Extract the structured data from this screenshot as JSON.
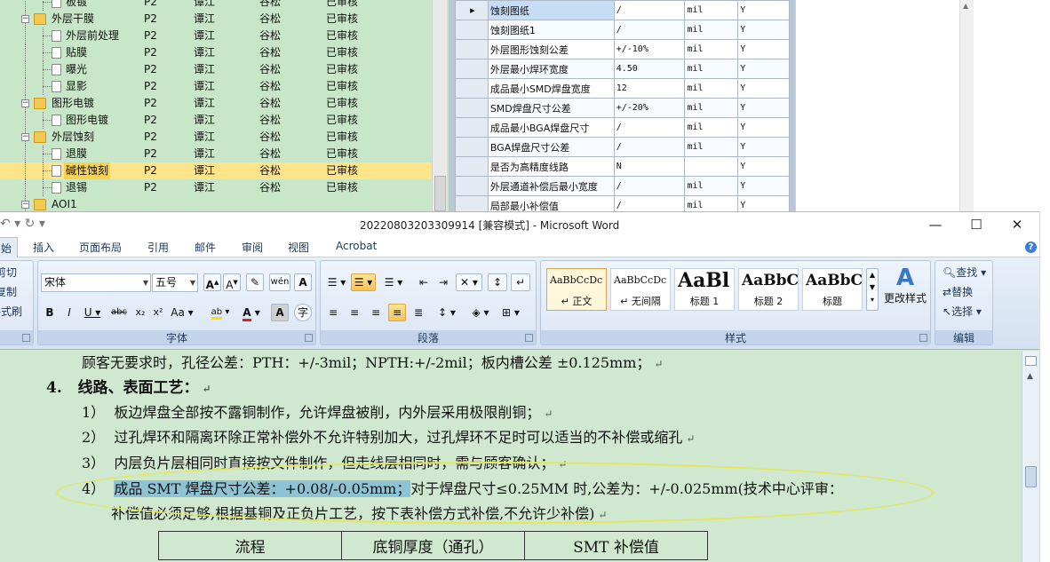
{
  "tree": {
    "rows": [
      {
        "name": "板镀",
        "code": "P2",
        "person": "谭江",
        "reviewer": "谷松",
        "status": "已审核",
        "icon": "file",
        "depth": 2
      },
      {
        "name": "外层干膜",
        "code": "P2",
        "person": "谭江",
        "reviewer": "谷松",
        "status": "已审核",
        "icon": "folder",
        "depth": 1
      },
      {
        "name": "外层前处理",
        "code": "P2",
        "person": "谭江",
        "reviewer": "谷松",
        "status": "已审核",
        "icon": "file",
        "depth": 2
      },
      {
        "name": "贴膜",
        "code": "P2",
        "person": "谭江",
        "reviewer": "谷松",
        "status": "已审核",
        "icon": "file",
        "depth": 2
      },
      {
        "name": "曝光",
        "code": "P2",
        "person": "谭江",
        "reviewer": "谷松",
        "status": "已审核",
        "icon": "file",
        "depth": 2
      },
      {
        "name": "显影",
        "code": "P2",
        "person": "谭江",
        "reviewer": "谷松",
        "status": "已审核",
        "icon": "file",
        "depth": 2
      },
      {
        "name": "图形电镀",
        "code": "P2",
        "person": "谭江",
        "reviewer": "谷松",
        "status": "已审核",
        "icon": "folder",
        "depth": 1
      },
      {
        "name": "图形电镀",
        "code": "P2",
        "person": "谭江",
        "reviewer": "谷松",
        "status": "已审核",
        "icon": "file",
        "depth": 2
      },
      {
        "name": "外层蚀刻",
        "code": "P2",
        "person": "谭江",
        "reviewer": "谷松",
        "status": "已审核",
        "icon": "folder",
        "depth": 1
      },
      {
        "name": "退膜",
        "code": "P2",
        "person": "谭江",
        "reviewer": "谷松",
        "status": "已审核",
        "icon": "file",
        "depth": 2
      },
      {
        "name": "碱性蚀刻",
        "code": "P2",
        "person": "谭江",
        "reviewer": "谷松",
        "status": "已审核",
        "icon": "file",
        "depth": 2,
        "selected": true
      },
      {
        "name": "退锡",
        "code": "P2",
        "person": "谭江",
        "reviewer": "谷松",
        "status": "已审核",
        "icon": "file",
        "depth": 2
      },
      {
        "name": "AOI1",
        "code": "",
        "person": "",
        "reviewer": "",
        "status": "",
        "icon": "folder",
        "depth": 1
      }
    ]
  },
  "grid": {
    "rows": [
      {
        "param": "蚀刻图纸",
        "value": "/",
        "unit": "mil",
        "flag": "Y",
        "current": true
      },
      {
        "param": "蚀刻图纸1",
        "value": "/",
        "unit": "mil",
        "flag": "Y"
      },
      {
        "param": "外层图形蚀刻公差",
        "value": "+/-10%",
        "unit": "mil",
        "flag": "Y"
      },
      {
        "param": "外层最小焊环宽度",
        "value": "4.50",
        "unit": "mil",
        "flag": "Y"
      },
      {
        "param": "成品最小SMD焊盘宽度",
        "value": "12",
        "unit": "mil",
        "flag": "Y"
      },
      {
        "param": "SMD焊盘尺寸公差",
        "value": "+/-20%",
        "unit": "mil",
        "flag": "Y"
      },
      {
        "param": "成品最小BGA焊盘尺寸",
        "value": "/",
        "unit": "mil",
        "flag": "Y"
      },
      {
        "param": "BGA焊盘尺寸公差",
        "value": "/",
        "unit": "mil",
        "flag": "Y"
      },
      {
        "param": "是否为高精度线路",
        "value": "N",
        "unit": "",
        "flag": "Y"
      },
      {
        "param": "外层通道补偿后最小宽度",
        "value": "/",
        "unit": "mil",
        "flag": "Y"
      },
      {
        "param": "局部最小补偿值",
        "value": "/",
        "unit": "mil",
        "flag": "Y"
      }
    ]
  },
  "word": {
    "title": "20220803203309914 [兼容模式] - Microsoft Word",
    "tabs": [
      "始",
      "插入",
      "页面布局",
      "引用",
      "邮件",
      "审阅",
      "视图",
      "Acrobat"
    ],
    "clipboard": {
      "cut": "剪切",
      "copy": "复制",
      "painter": "格式刷"
    },
    "font": {
      "name": "宋体",
      "size": "五号",
      "group_label": "字体"
    },
    "paragraph": {
      "group_label": "段落"
    },
    "styles": {
      "group_label": "样式",
      "items": [
        {
          "preview": "AaBbCcDc",
          "name": "↵ 正文"
        },
        {
          "preview": "AaBbCcDc",
          "name": "↵ 无间隔"
        },
        {
          "preview": "AaBl",
          "name": "标题 1"
        },
        {
          "preview": "AaBbC",
          "name": "标题 2"
        },
        {
          "preview": "AaBbC",
          "name": "标题"
        }
      ],
      "change_label": "更改样式"
    },
    "editing": {
      "find": "查找",
      "replace": "替换",
      "select": "选择",
      "group_label": "编辑"
    },
    "doc": {
      "line0": "顾客无要求时，孔径公差：PTH：+/-3mil；NPTH:+/-2mil；板内槽公差 ±0.125mm；",
      "heading_num": "4.",
      "heading": "线路、表面工艺：",
      "items": [
        {
          "num": "1）",
          "text": "板边焊盘全部按不露铜制作，允许焊盘被削，内外层采用极限削铜；"
        },
        {
          "num": "2）",
          "text": "过孔焊环和隔离环除正常补偿外不允许特别加大，过孔焊环不足时可以适当的不补偿或缩孔"
        },
        {
          "num": "3）",
          "text": "内层负片层相同时直接按文件制作，但走线层相同时，需与顾客确认；"
        }
      ],
      "item4_num": "4）",
      "item4_highlight": "成品 SMT 焊盘尺寸公差：+0.08/-0.05mm；",
      "item4_rest": "对于焊盘尺寸≤0.25MM 时,公差为：+/-0.025mm(技术中心评审：",
      "item4_line2": "补偿值必须足够,根据基铜及正负片工艺，按下表补偿方式补偿,不允许少补偿)",
      "table_headers": [
        "流程",
        "底铜厚度（通孔）",
        "SMT 补偿值"
      ]
    }
  }
}
